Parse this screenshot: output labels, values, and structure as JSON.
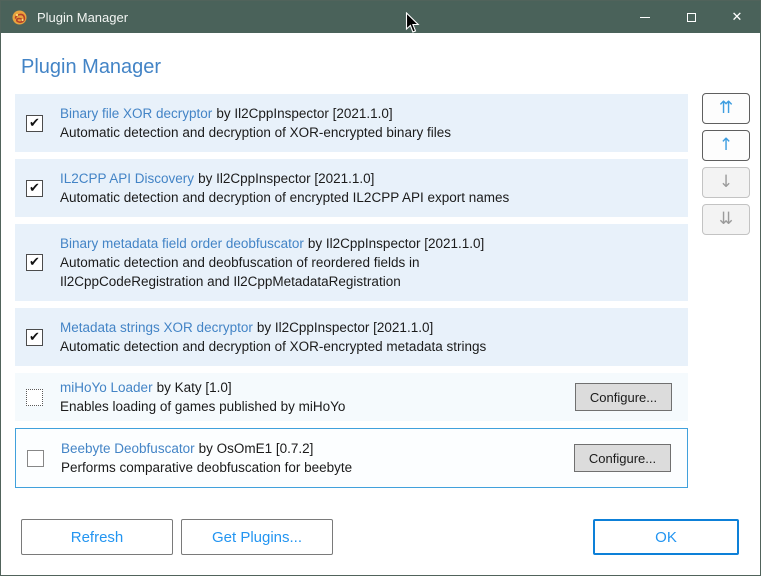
{
  "window": {
    "title": "Plugin Manager",
    "close_glyph": "✕"
  },
  "header": {
    "title": "Plugin Manager"
  },
  "plugins": [
    {
      "name": "Binary file XOR decryptor",
      "author": "by Il2CppInspector [2021.1.0]",
      "description": "Automatic detection and decryption of XOR-encrypted binary files",
      "state": "checked",
      "selected": false,
      "compact": false,
      "configure_label": null
    },
    {
      "name": "IL2CPP API Discovery",
      "author": "by Il2CppInspector [2021.1.0]",
      "description": "Automatic detection and decryption of encrypted IL2CPP API export names",
      "state": "checked",
      "selected": false,
      "compact": false,
      "configure_label": null
    },
    {
      "name": "Binary metadata field order deobfuscator",
      "author": "by Il2CppInspector [2021.1.0]",
      "description": "Automatic detection and deobfuscation of reordered fields in\nIl2CppCodeRegistration and Il2CppMetadataRegistration",
      "state": "checked",
      "selected": false,
      "compact": false,
      "configure_label": null
    },
    {
      "name": "Metadata strings XOR decryptor",
      "author": "by Il2CppInspector [2021.1.0]",
      "description": "Automatic detection and decryption of XOR-encrypted metadata strings",
      "state": "checked",
      "selected": false,
      "compact": false,
      "configure_label": null
    },
    {
      "name": "miHoYo Loader",
      "author": "by Katy [1.0]",
      "description": "Enables loading of games published by miHoYo",
      "state": "indeterminate",
      "selected": false,
      "compact": true,
      "configure_label": "Configure..."
    },
    {
      "name": "Beebyte Deobfuscator",
      "author": "by OsOmE1 [0.7.2]",
      "description": "Performs comparative deobfuscation for beebyte",
      "state": "unchecked",
      "selected": true,
      "compact": false,
      "configure_label": "Configure..."
    }
  ],
  "checkbox_glyphs": {
    "checked": "✔",
    "indeterminate": "",
    "unchecked": ""
  },
  "order_buttons": [
    {
      "name": "move-to-top-button",
      "icon": "double-up-arrow-icon",
      "glyph": "⇈",
      "enabled": true
    },
    {
      "name": "move-up-button",
      "icon": "up-arrow-icon",
      "glyph": "↑",
      "enabled": true
    },
    {
      "name": "move-down-button",
      "icon": "down-arrow-icon",
      "glyph": "↓",
      "enabled": false
    },
    {
      "name": "move-to-bottom-button",
      "icon": "double-down-arrow-icon",
      "glyph": "⇊",
      "enabled": false
    }
  ],
  "footer": {
    "refresh": "Refresh",
    "get_plugins": "Get Plugins...",
    "ok": "OK"
  },
  "colors": {
    "titlebar": "#4a625a",
    "window-border": "#51635b",
    "accent_blue": "#4384c6",
    "row_bg": "#e8f1fa",
    "row_bg_pale": "#f5fafd",
    "selected_border": "#41a1dc",
    "arrow_blue": "#3f9ee0",
    "button_text_blue": "#2395f1",
    "ok_border": "#0d80d8"
  }
}
